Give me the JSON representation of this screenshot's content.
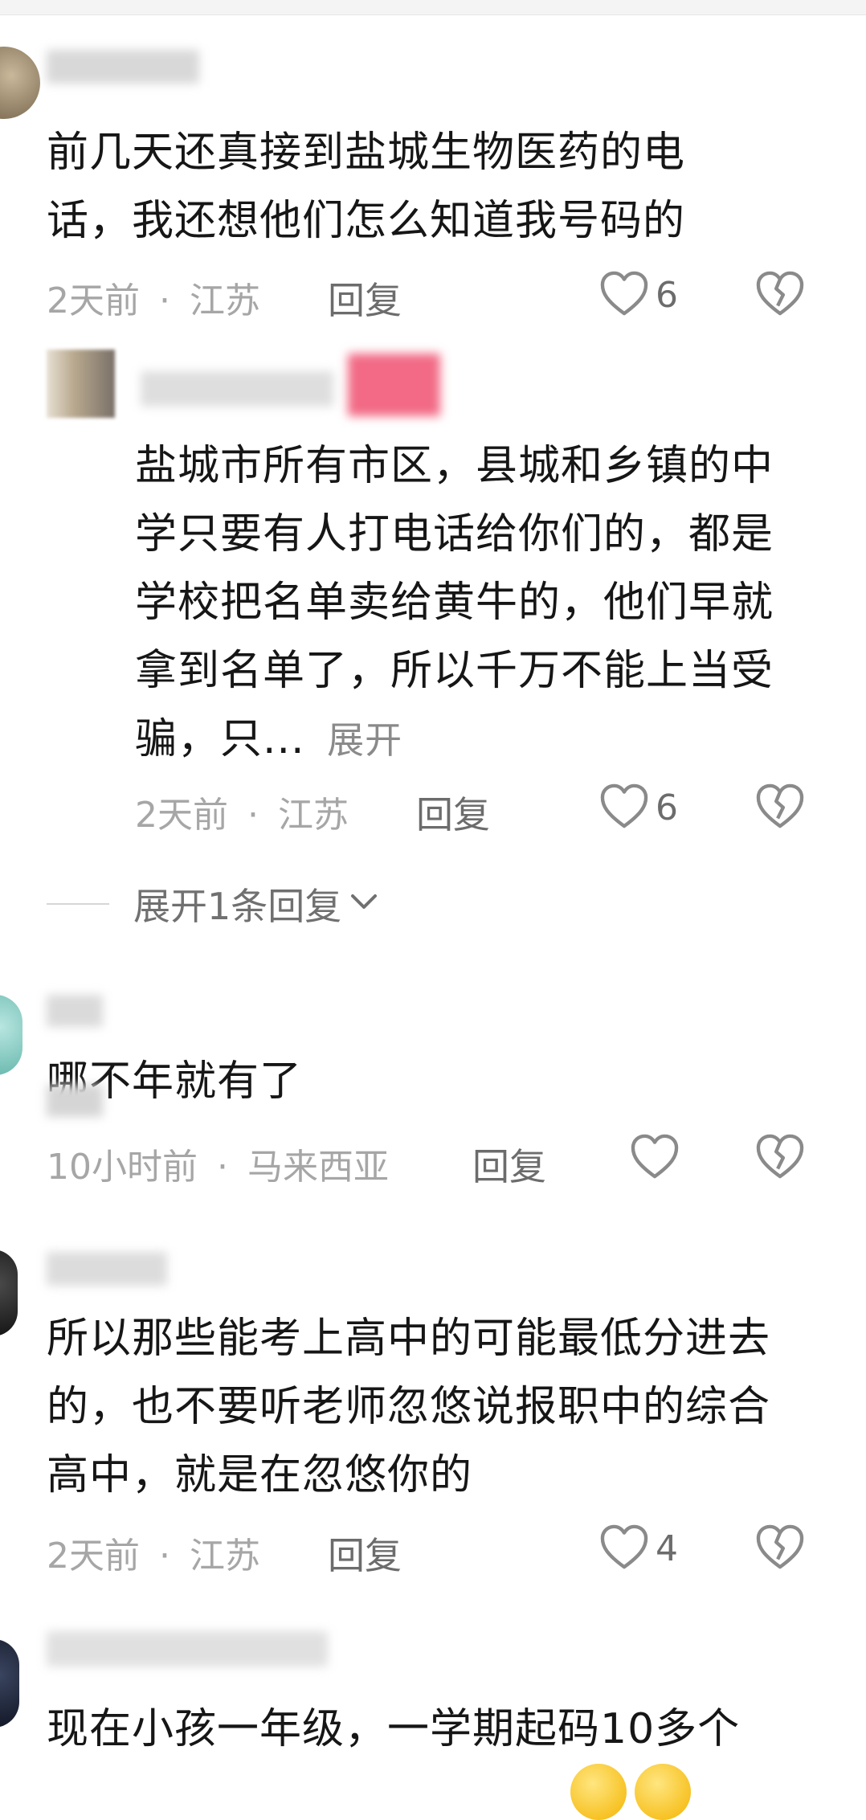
{
  "comments": [
    {
      "text": "前几天还真接到盐城生物医药的电话，我还想他们怎么知道我号码的",
      "time": "2天前",
      "sep": "·",
      "location": "江苏",
      "reply_label": "回复",
      "likes": "6"
    },
    {
      "text": "盐城市所有市区，县城和乡镇的中学只要有人打电话给你们的，都是学校把名单卖给黄牛的，他们早就拿到名单了，所以千万不能上当受骗，只...",
      "expand_label": "展开",
      "time": "2天前",
      "sep": "·",
      "location": "江苏",
      "reply_label": "回复",
      "likes": "6"
    },
    {
      "text": "哪不年就有了",
      "time": "10小时前",
      "sep": "·",
      "location": "马来西亚",
      "reply_label": "回复",
      "likes": ""
    },
    {
      "text": "所以那些能考上高中的可能最低分进去的，也不要听老师忽悠说报职中的综合高中，就是在忽悠你的",
      "time": "2天前",
      "sep": "·",
      "location": "江苏",
      "reply_label": "回复",
      "likes": "4"
    },
    {
      "text": "现在小孩一年级，一学期起码10多个"
    }
  ],
  "more_replies_label": "展开1条回复",
  "icons": {
    "like": "heart-outline-icon",
    "dislike": "broken-heart-icon",
    "chevron": "chevron-down-icon"
  }
}
